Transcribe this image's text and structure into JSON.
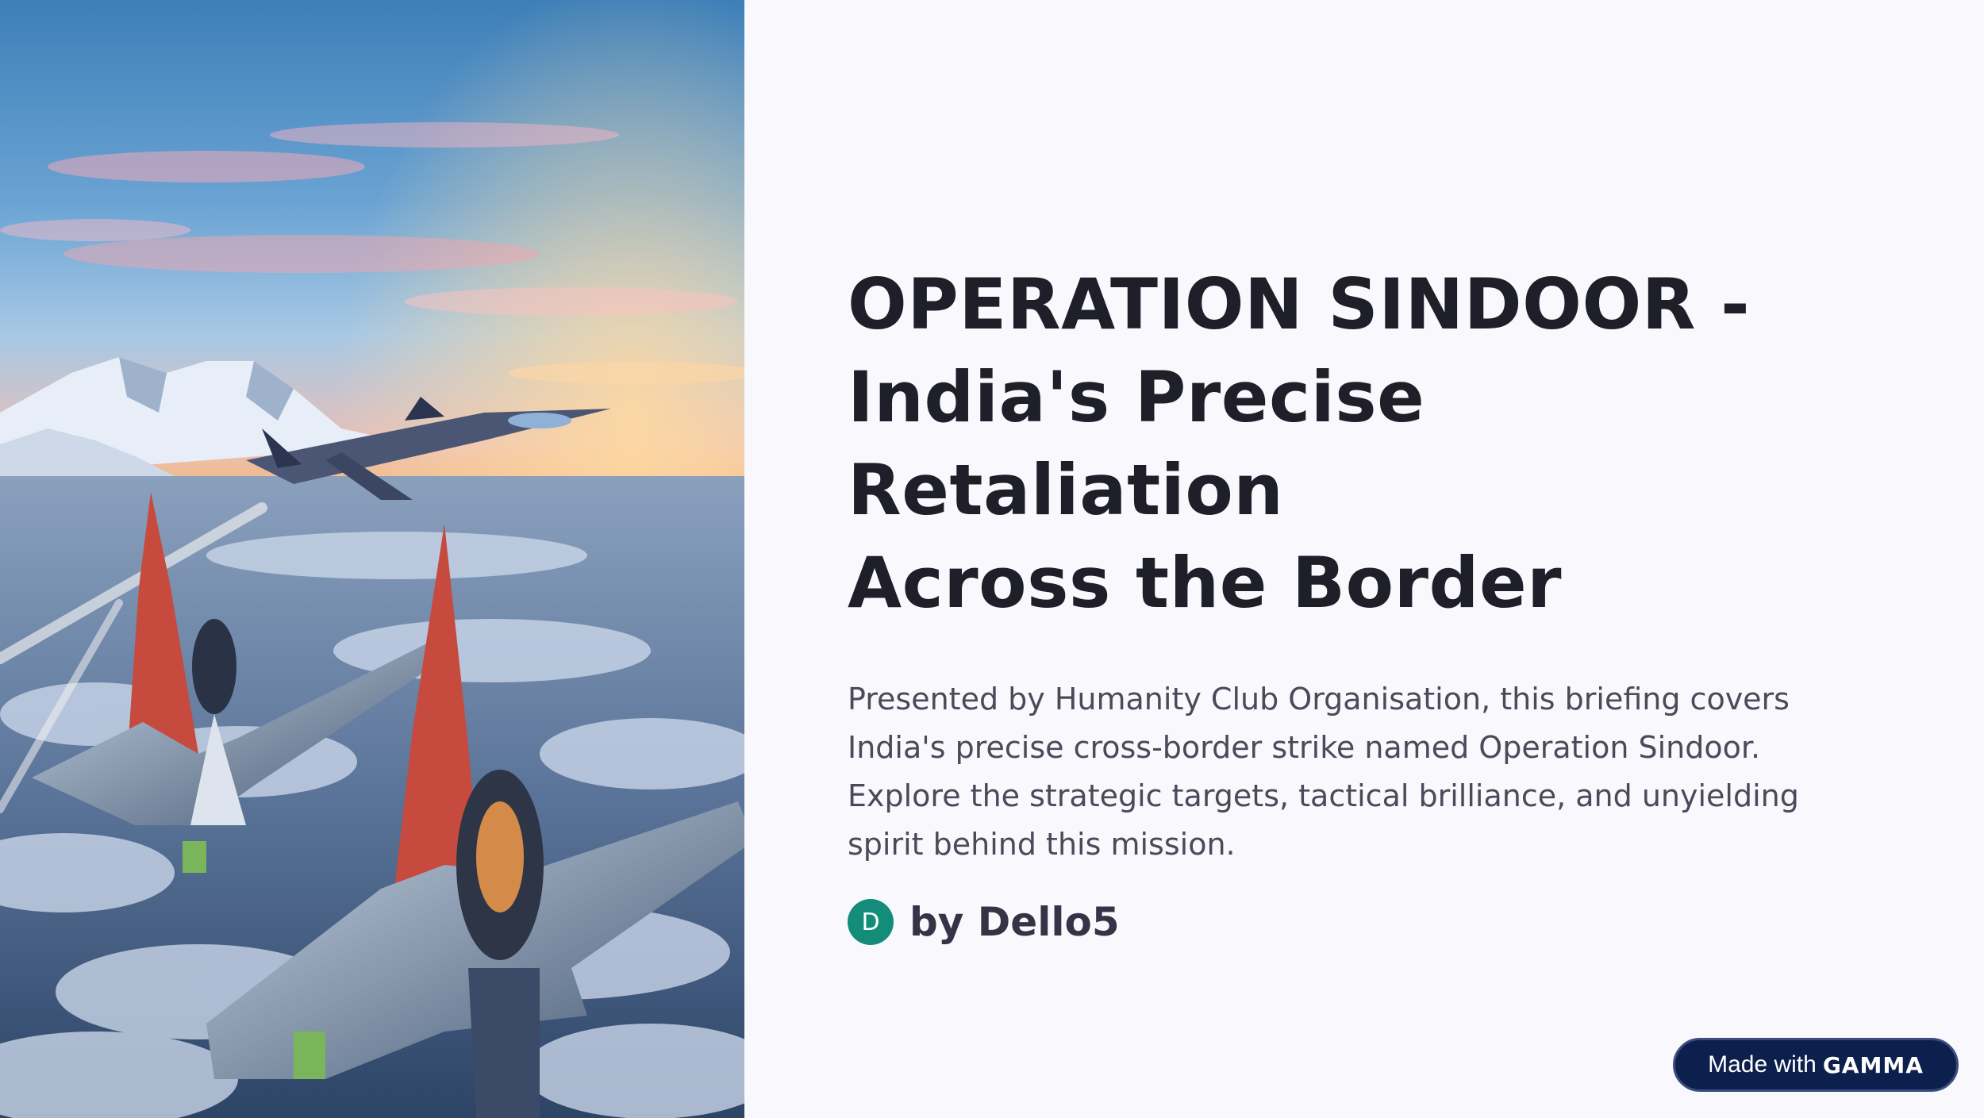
{
  "slide": {
    "title_lines": [
      "OPERATION SINDOOR -",
      "India's Precise Retaliation",
      "Across the Border"
    ],
    "description": "Presented by Humanity Club Organisation, this briefing covers India's precise cross-border strike named Operation Sindoor. Explore the strategic targets, tactical brilliance, and unyielding spirit behind this mission.",
    "author": {
      "initial": "D",
      "name": "by Dello5"
    },
    "hero_image": {
      "icon": "fighter-jets-over-mountains-image"
    }
  },
  "badge": {
    "prefix": "Made with",
    "brand": "GAMMA"
  },
  "colors": {
    "background": "#f8f8fd",
    "title": "#1f1f2a",
    "description": "#4a4a5a",
    "avatar": "#138d7a",
    "badge": "#0d1f4d"
  }
}
